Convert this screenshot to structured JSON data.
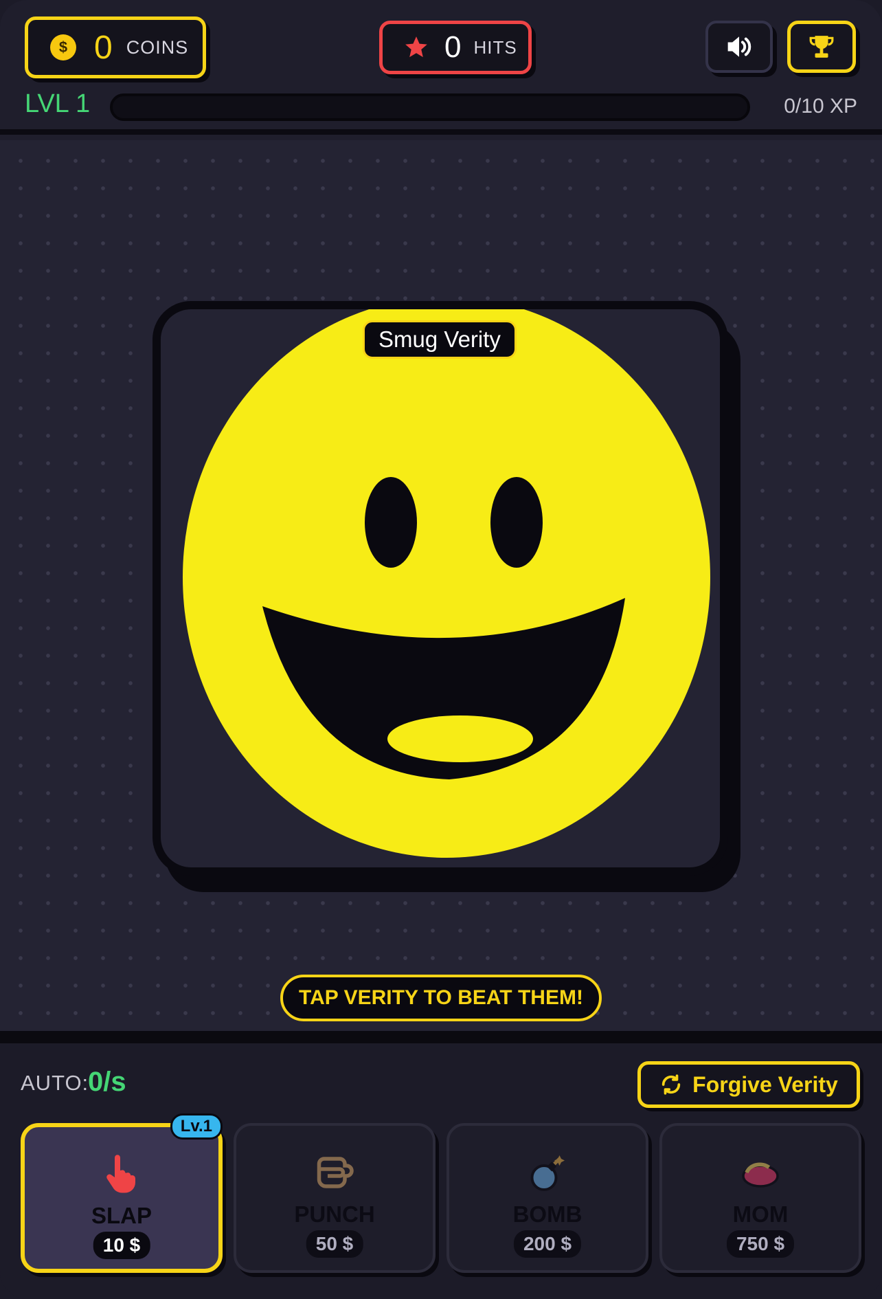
{
  "header": {
    "coins_value": "0",
    "coins_label": "COINS",
    "hits_value": "0",
    "hits_label": "HITS",
    "level_label": "LVL 1",
    "xp_text": "0/10 XP",
    "xp_progress": 0
  },
  "arena": {
    "target_name": "Smug Verity",
    "tap_hint": "TAP VERITY TO BEAT THEM!"
  },
  "footer": {
    "auto_label": "AUTO:",
    "auto_value": "0/s",
    "forgive_label": "Forgive Verity"
  },
  "weapons": [
    {
      "name": "SLAP",
      "price": "10 $",
      "badge": "Lv.1",
      "icon": "pointing-hand-icon",
      "active": true
    },
    {
      "name": "PUNCH",
      "price": "50 $",
      "icon": "fist-icon",
      "active": false
    },
    {
      "name": "BOMB",
      "price": "200 $",
      "icon": "bomb-icon",
      "active": false
    },
    {
      "name": "MOM",
      "price": "750 $",
      "icon": "slipper-icon",
      "active": false
    }
  ],
  "colors": {
    "accent_yellow": "#f7d417",
    "hits_red": "#ef4446",
    "level_green": "#45d675",
    "badge_blue": "#37b6ee",
    "background": "#1f1e2c"
  }
}
